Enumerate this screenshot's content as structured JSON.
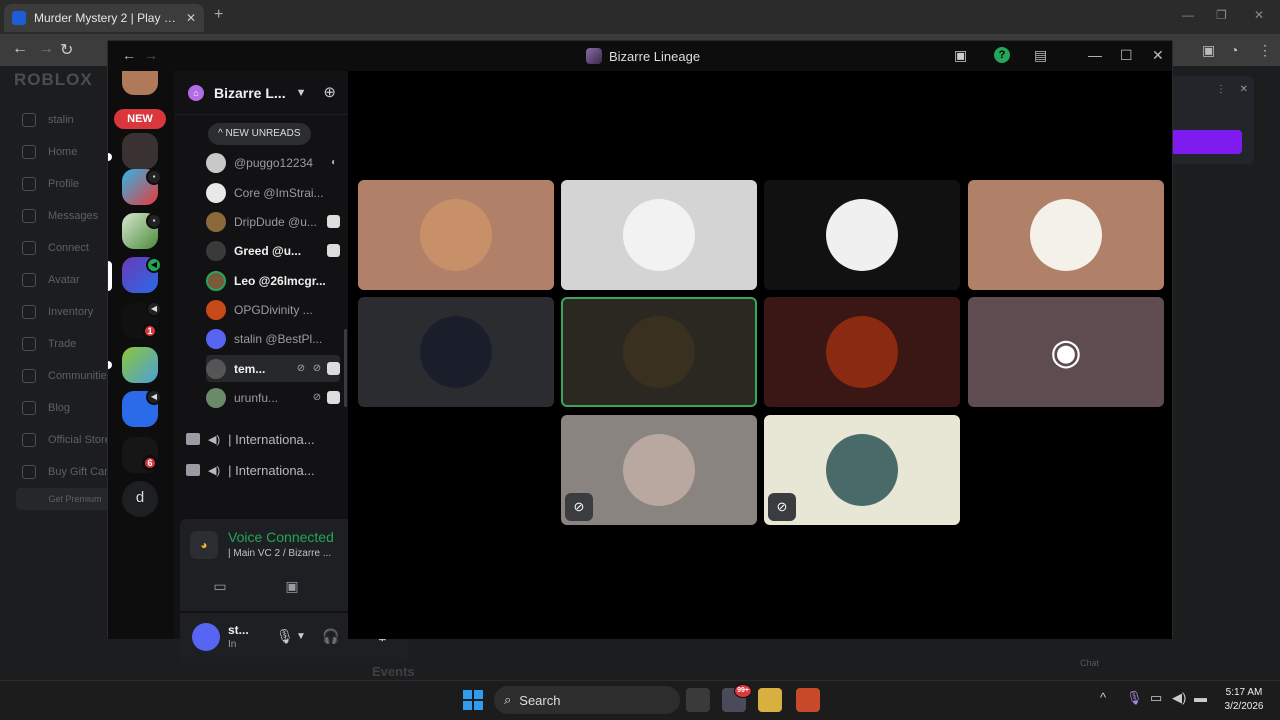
{
  "browser": {
    "tab_title": "Murder Mystery 2 | Play on Roblox",
    "new_tab": "+"
  },
  "roblox": {
    "logo": "ROBLOX",
    "menu": [
      "stalin",
      "Home",
      "Profile",
      "Messages",
      "Connect",
      "Avatar",
      "Inventory",
      "Trade",
      "Communities",
      "Blog",
      "Official Store",
      "Buy Gift Cards"
    ],
    "premium": "Get Premium",
    "events": "Events",
    "chat": "Chat"
  },
  "discord": {
    "window_title": "Bizarre Lineage",
    "server_name": "Bizarre L...",
    "new_label": "NEW",
    "new_unreads": "NEW UNREADS",
    "rail_badges": [
      "1",
      "6"
    ],
    "rail_letter": "d",
    "members": [
      {
        "name": "@puggo12234",
        "bold": false
      },
      {
        "name": "Core @ImStrai...",
        "bold": false
      },
      {
        "name": "DripDude @u...",
        "bold": false
      },
      {
        "name": "Greed @u...",
        "bold": true
      },
      {
        "name": "Leo @26lmcgr...",
        "bold": true
      },
      {
        "name": "OPGDivinity ...",
        "bold": false
      },
      {
        "name": "stalin @BestPl...",
        "bold": false
      },
      {
        "name": "tem...",
        "bold": true
      },
      {
        "name": "urunfu...",
        "bold": false
      }
    ],
    "voice_channels": [
      "| Internationa...",
      "| Internationa..."
    ],
    "voice": {
      "title": "Voice Connected",
      "subtitle": "| Main VC 2 / Bizarre ..."
    },
    "user": {
      "name": "st...",
      "status": "In"
    }
  },
  "taskbar": {
    "search_label": "Search",
    "time": "5:17 AM",
    "date": "3/2/2026",
    "notif_badge": "99+"
  },
  "colors": {
    "voice_green": "#23a55a",
    "speaking_border": "#3ba55c",
    "new_red": "#da373c",
    "blurple": "#5865f2"
  }
}
